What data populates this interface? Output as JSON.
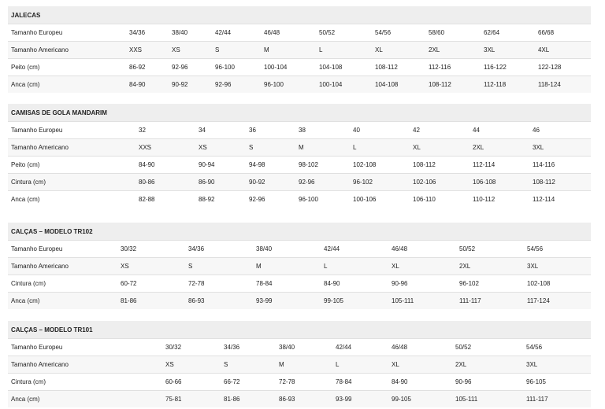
{
  "tables": [
    {
      "title": "JALECAS",
      "rows": [
        {
          "label": "Tamanho Europeu",
          "values": [
            "34/36",
            "38/40",
            "42/44",
            "46/48",
            "50/52",
            "54/56",
            "58/60",
            "62/64",
            "66/68"
          ]
        },
        {
          "label": "Tamanho Americano",
          "values": [
            "XXS",
            "XS",
            "S",
            "M",
            "L",
            "XL",
            "2XL",
            "3XL",
            "4XL"
          ]
        },
        {
          "label": "Peito (cm)",
          "values": [
            "86-92",
            "92-96",
            "96-100",
            "100-104",
            "104-108",
            "108-112",
            "112-116",
            "116-122",
            "122-128"
          ]
        },
        {
          "label": "Anca (cm)",
          "values": [
            "84-90",
            "90-92",
            "92-96",
            "96-100",
            "100-104",
            "104-108",
            "108-112",
            "112-118",
            "118-124"
          ]
        }
      ]
    },
    {
      "title": "CAMISAS DE GOLA MANDARIM",
      "rows": [
        {
          "label": "Tamanho Europeu",
          "values": [
            "32",
            "34",
            "36",
            "38",
            "40",
            "42",
            "44",
            "46"
          ]
        },
        {
          "label": "Tamanho Americano",
          "values": [
            "XXS",
            "XS",
            "S",
            "M",
            "L",
            "XL",
            "2XL",
            "3XL"
          ]
        },
        {
          "label": "Peito (cm)",
          "values": [
            "84-90",
            "90-94",
            "94-98",
            "98-102",
            "102-108",
            "108-112",
            "112-114",
            "114-116"
          ]
        },
        {
          "label": "Cintura (cm)",
          "values": [
            "80-86",
            "86-90",
            "90-92",
            "92-96",
            "96-102",
            "102-106",
            "106-108",
            "108-112"
          ]
        },
        {
          "label": "Anca (cm)",
          "values": [
            "82-88",
            "88-92",
            "92-96",
            "96-100",
            "100-106",
            "106-110",
            "110-112",
            "112-114"
          ]
        }
      ]
    },
    {
      "title": "CALÇAS – MODELO TR102",
      "rows": [
        {
          "label": "Tamanho Europeu",
          "values": [
            "30/32",
            "34/36",
            "38/40",
            "42/44",
            "46/48",
            "50/52",
            "54/56"
          ]
        },
        {
          "label": "Tamanho Americano",
          "values": [
            "XS",
            "S",
            "M",
            "L",
            "XL",
            "2XL",
            "3XL"
          ]
        },
        {
          "label": "Cintura (cm)",
          "values": [
            "60-72",
            "72-78",
            "78-84",
            "84-90",
            "90-96",
            "96-102",
            "102-108"
          ]
        },
        {
          "label": "Anca (cm)",
          "values": [
            "81-86",
            "86-93",
            "93-99",
            "99-105",
            "105-111",
            "111-117",
            "117-124"
          ]
        }
      ]
    },
    {
      "title": "CALÇAS – MODELO TR101",
      "rows": [
        {
          "label": "Tamanho Europeu",
          "values": [
            "30/32",
            "34/36",
            "38/40",
            "42/44",
            "46/48",
            "50/52",
            "54/56"
          ]
        },
        {
          "label": "Tamanho Americano",
          "values": [
            "XS",
            "S",
            "M",
            "L",
            "XL",
            "2XL",
            "3XL"
          ]
        },
        {
          "label": "Cintura (cm)",
          "values": [
            "60-66",
            "66-72",
            "72-78",
            "78-84",
            "84-90",
            "90-96",
            "96-105"
          ]
        },
        {
          "label": "Anca (cm)",
          "values": [
            "75-81",
            "81-86",
            "86-93",
            "93-99",
            "99-105",
            "105-111",
            "111-117"
          ]
        }
      ]
    }
  ]
}
